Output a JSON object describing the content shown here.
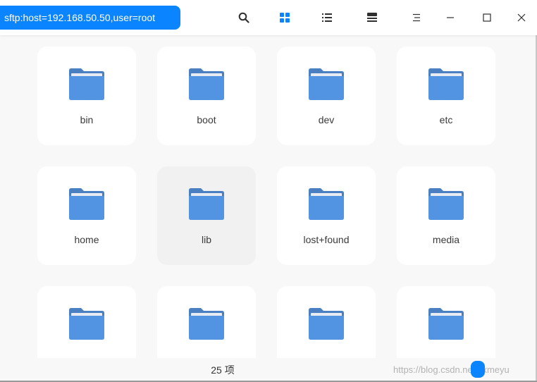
{
  "titlebar": {
    "address": "sftp:host=192.168.50.50,user=root",
    "buttons": [
      "search-icon",
      "icon-view-icon",
      "list-view-icon",
      "detail-view-icon",
      "menu-icon",
      "minimize-icon",
      "maximize-icon",
      "close-icon"
    ]
  },
  "colors": {
    "accent": "#0a84ff",
    "folder_body": "#5294e2",
    "folder_tab": "#4a7fc1",
    "folder_paper": "#e8ecf2"
  },
  "items": [
    {
      "label": "bin"
    },
    {
      "label": "boot"
    },
    {
      "label": "dev"
    },
    {
      "label": "etc"
    },
    {
      "label": "home"
    },
    {
      "label": "lib",
      "selected": true
    },
    {
      "label": "lost+found"
    },
    {
      "label": "media"
    },
    {
      "label": ""
    },
    {
      "label": ""
    },
    {
      "label": ""
    },
    {
      "label": ""
    }
  ],
  "status": {
    "count": "25 项",
    "watermark": "https://blog.csdn.net/kxmeyu"
  }
}
